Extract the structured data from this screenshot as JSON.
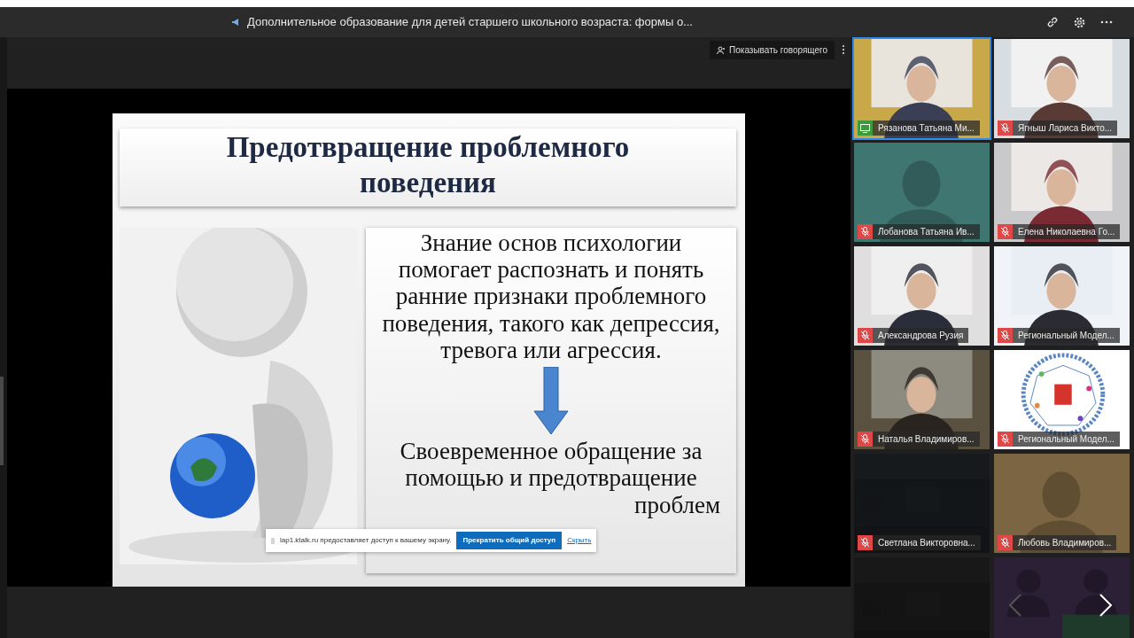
{
  "meeting": {
    "title": "Дополнительное образование для детей старшего школьного возраста: формы о..."
  },
  "stage": {
    "speaker_button": "Показывать говорящего"
  },
  "slide": {
    "title": "Предотвращение проблемного поведения",
    "paragraph_1": "Знание основ психологии помогает распознать и понять ранние признаки проблемного поведения, такого как депрессия, тревога или агрессия.",
    "paragraph_2": "Своевременное обращение за помощью и предотвращение",
    "paragraph_2_tail": "проблем"
  },
  "share_notice": {
    "text": "lap1.ktalk.ru предоставляет доступ к вашему экрану.",
    "stop_button": "Прекратить общий доступ",
    "hide_link": "Скрыть"
  },
  "participants": [
    {
      "name": "Рязанова Татьяна Ми...",
      "sharing": true,
      "speaking": true,
      "kind": "video"
    },
    {
      "name": "Ягныш Лариса Викто...",
      "sharing": false,
      "muted": true,
      "speaking": false,
      "kind": "video"
    },
    {
      "name": "Лобанова Татьяна Ив...",
      "sharing": false,
      "muted": true,
      "speaking": false,
      "kind": "avatar",
      "color": "#3f7672"
    },
    {
      "name": "Елена Николаевна Го...",
      "sharing": false,
      "muted": true,
      "speaking": false,
      "kind": "video"
    },
    {
      "name": "Александрова Рузия",
      "sharing": false,
      "muted": true,
      "speaking": false,
      "kind": "video"
    },
    {
      "name": "Региональный Модел...",
      "sharing": false,
      "muted": true,
      "speaking": false,
      "kind": "video"
    },
    {
      "name": "Наталья Владимиров...",
      "sharing": false,
      "muted": true,
      "speaking": false,
      "kind": "video"
    },
    {
      "name": "Региональный Модел...",
      "sharing": false,
      "muted": true,
      "speaking": false,
      "kind": "logo"
    },
    {
      "name": "Светлана Викторовна...",
      "sharing": false,
      "muted": true,
      "speaking": false,
      "kind": "blank",
      "color": "#131619"
    },
    {
      "name": "Любовь Владимиров...",
      "sharing": false,
      "muted": true,
      "speaking": false,
      "kind": "avatar",
      "color": "#7b6542"
    },
    {
      "kind": "blank",
      "speaking": false,
      "color": "#151414"
    },
    {
      "kind": "group",
      "speaking": false,
      "color": "#2b2036"
    }
  ],
  "pager": {
    "prev_disabled": true,
    "next_disabled": false
  }
}
